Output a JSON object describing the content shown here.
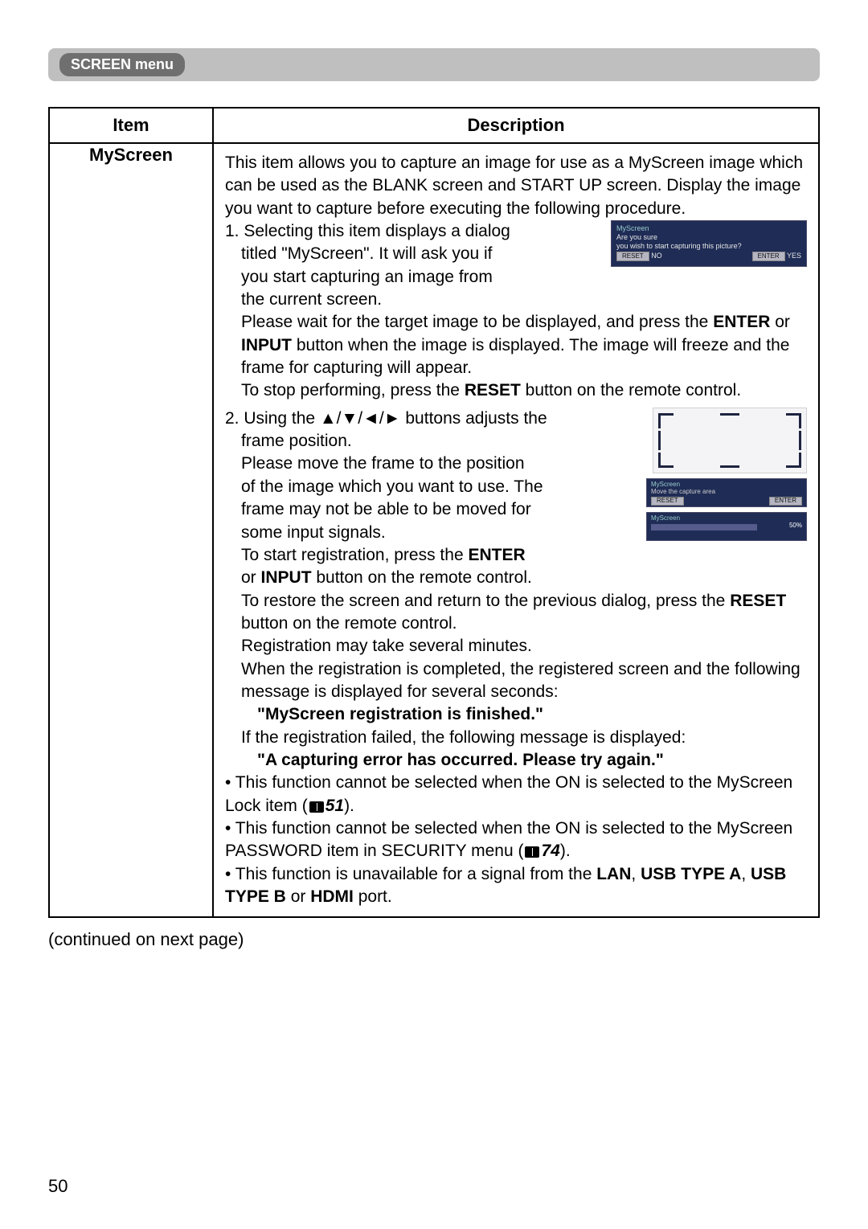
{
  "section_header": "SCREEN menu",
  "table": {
    "headers": {
      "item": "Item",
      "description": "Description"
    },
    "row": {
      "item": "MyScreen",
      "intro": "This item allows you to capture an image for use as a MyScreen image which can be used as the BLANK screen and START UP screen. Display the image you want to capture before executing the following procedure.",
      "step1_a": "1. Selecting this item displays a dialog",
      "step1_b": "titled \"MyScreen\". It will ask you if",
      "step1_c": "you start capturing an image from",
      "step1_d": "the current screen.",
      "step1_wait_a": "Please wait for the target image to be displayed, and press the ",
      "enter": "ENTER",
      "or": " or ",
      "input": "INPUT",
      "step1_wait_b": " button when the image is displayed. The image will freeze and the frame for capturing will appear.",
      "step1_stop_a": "To stop performing, press the ",
      "reset": "RESET",
      "step1_stop_b": " button on the remote control.",
      "step2_a": "2. Using the ▲/▼/◄/► buttons adjusts the",
      "step2_b": "frame position.",
      "step2_c": "Please move the frame to the position",
      "step2_d": "of the image which you want to use. The",
      "step2_e": "frame may not be able to be moved for",
      "step2_f": "some input signals.",
      "step2_g_a": "To start registration, press the ",
      "step2_g_b": "or ",
      "step2_g_c": " button on the remote control.",
      "restore_a": "To restore the screen and return to the previous dialog, press the ",
      "restore_b": " button on the remote control.",
      "reg_minutes": "Registration may take several minutes.",
      "reg_done_a": "When the registration is completed, the registered screen and the following message is displayed for several seconds:",
      "reg_finished": "\"MyScreen registration is finished.\"",
      "reg_fail_a": "If the registration failed, the following message is displayed:",
      "reg_fail_msg": "\"A capturing error has occurred. Please try again.\"",
      "note1_a": "• This function cannot be selected when the ON is selected to the MyScreen Lock item (",
      "note1_ref": "51",
      "note1_b": ").",
      "note2_a": "• This function cannot be selected when the ON is selected to the MyScreen PASSWORD item in SECURITY menu (",
      "note2_ref": "74",
      "note2_b": ").",
      "note3_a": "• This function is unavailable for a signal from the ",
      "lan": "LAN",
      "comma": ", ",
      "usb_a": "USB TYPE A",
      "usb_b": "USB TYPE B",
      "hdmi": "HDMI",
      "port": " port."
    }
  },
  "dialog1": {
    "title": "MyScreen",
    "q1": "Are you sure",
    "q2": "you wish to start capturing this picture?",
    "reset": "RESET",
    "reset_hint": "NO",
    "enter": "ENTER",
    "enter_hint": "YES"
  },
  "dialog2": {
    "title": "MyScreen",
    "line": "Move the capture area",
    "reset": "RESET",
    "enter": "ENTER"
  },
  "dialog3": {
    "title": "MyScreen",
    "pct": "50%"
  },
  "continued": "(continued on next page)",
  "page_number": "50"
}
